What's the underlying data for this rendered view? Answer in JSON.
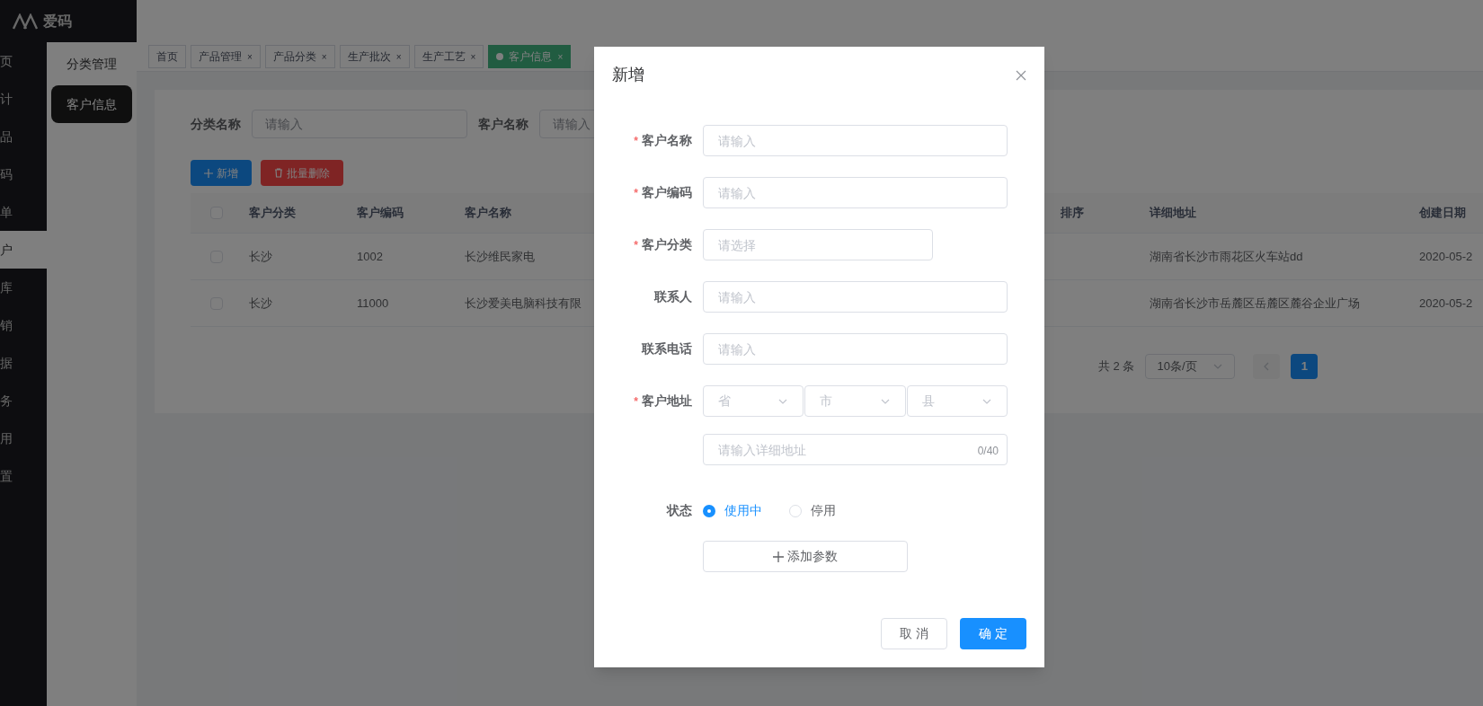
{
  "logo": {
    "text": "爱码"
  },
  "nav": [
    {
      "label": "页",
      "selected": false
    },
    {
      "label": "计",
      "selected": false
    },
    {
      "label": "品",
      "selected": false
    },
    {
      "label": "码",
      "selected": false
    },
    {
      "label": "单",
      "selected": false
    },
    {
      "label": "户",
      "selected": true
    },
    {
      "label": "库",
      "selected": false
    },
    {
      "label": "销",
      "selected": false
    },
    {
      "label": "据",
      "selected": false
    },
    {
      "label": "务",
      "selected": false
    },
    {
      "label": "用",
      "selected": false
    },
    {
      "label": "置",
      "selected": false
    }
  ],
  "subnav": {
    "title": "分类管理",
    "items": [
      {
        "label": "客户信息",
        "selected": true
      }
    ]
  },
  "tabs": [
    {
      "label": "首页",
      "selected": false
    },
    {
      "label": "产品管理",
      "close": "×",
      "selected": false
    },
    {
      "label": "产品分类",
      "close": "×",
      "selected": false
    },
    {
      "label": "生产批次",
      "close": "×",
      "selected": false
    },
    {
      "label": "生产工艺",
      "close": "×",
      "selected": false
    },
    {
      "label": "客户信息",
      "close": "×",
      "selected": true
    }
  ],
  "filters": [
    {
      "label": "分类名称",
      "placeholder": "请输入"
    },
    {
      "label": "客户名称",
      "placeholder": "请输入"
    }
  ],
  "actions": [
    {
      "kind": "add",
      "label": "新增"
    },
    {
      "kind": "delete",
      "label": "批量删除"
    }
  ],
  "table": {
    "header_checked": false,
    "columns": [
      "客户分类",
      "客户编码",
      "客户名称",
      "排序",
      "详细地址",
      "创建日期"
    ],
    "rows": [
      {
        "checked": false,
        "cells": [
          "长沙",
          "1002",
          "长沙维民家电",
          "",
          "湖南省长沙市雨花区火车站dd",
          "2020-05-2"
        ]
      },
      {
        "checked": false,
        "cells": [
          "长沙",
          "11000",
          "长沙爱美电脑科技有限",
          "",
          "湖南省长沙市岳麓区岳麓区麓谷企业广场",
          "2020-05-2"
        ]
      }
    ]
  },
  "pagination": {
    "total": "共 2 条",
    "page_size": "10条/页",
    "pages": [
      {
        "label": "1",
        "selected": true
      }
    ]
  },
  "dialog": {
    "title": "新增",
    "fields": [
      {
        "kind": "input",
        "mark": "*",
        "label": "客户名称",
        "placeholder": "请输入"
      },
      {
        "kind": "input",
        "mark": "*",
        "label": "客户编码",
        "placeholder": "请输入"
      },
      {
        "kind": "select",
        "mark": "*",
        "label": "客户分类",
        "placeholder": "请选择"
      },
      {
        "kind": "input",
        "label": "联系人",
        "placeholder": "请输入"
      },
      {
        "kind": "input",
        "label": "联系电话",
        "placeholder": "请输入"
      },
      {
        "kind": "region",
        "mark": "*",
        "label": "客户地址",
        "selects": [
          "省",
          "市",
          "县"
        ]
      },
      {
        "kind": "textarea",
        "placeholder": "请输入详细地址",
        "counter": "0/40"
      },
      {
        "kind": "radio",
        "label": "状态",
        "options": [
          {
            "label": "使用中",
            "selected": true
          },
          {
            "label": "停用",
            "selected": false
          }
        ]
      },
      {
        "kind": "button",
        "text": "添加参数"
      }
    ],
    "buttons": [
      {
        "kind": "cancel",
        "label": "取 消"
      },
      {
        "kind": "confirm",
        "label": "确 定"
      }
    ]
  }
}
